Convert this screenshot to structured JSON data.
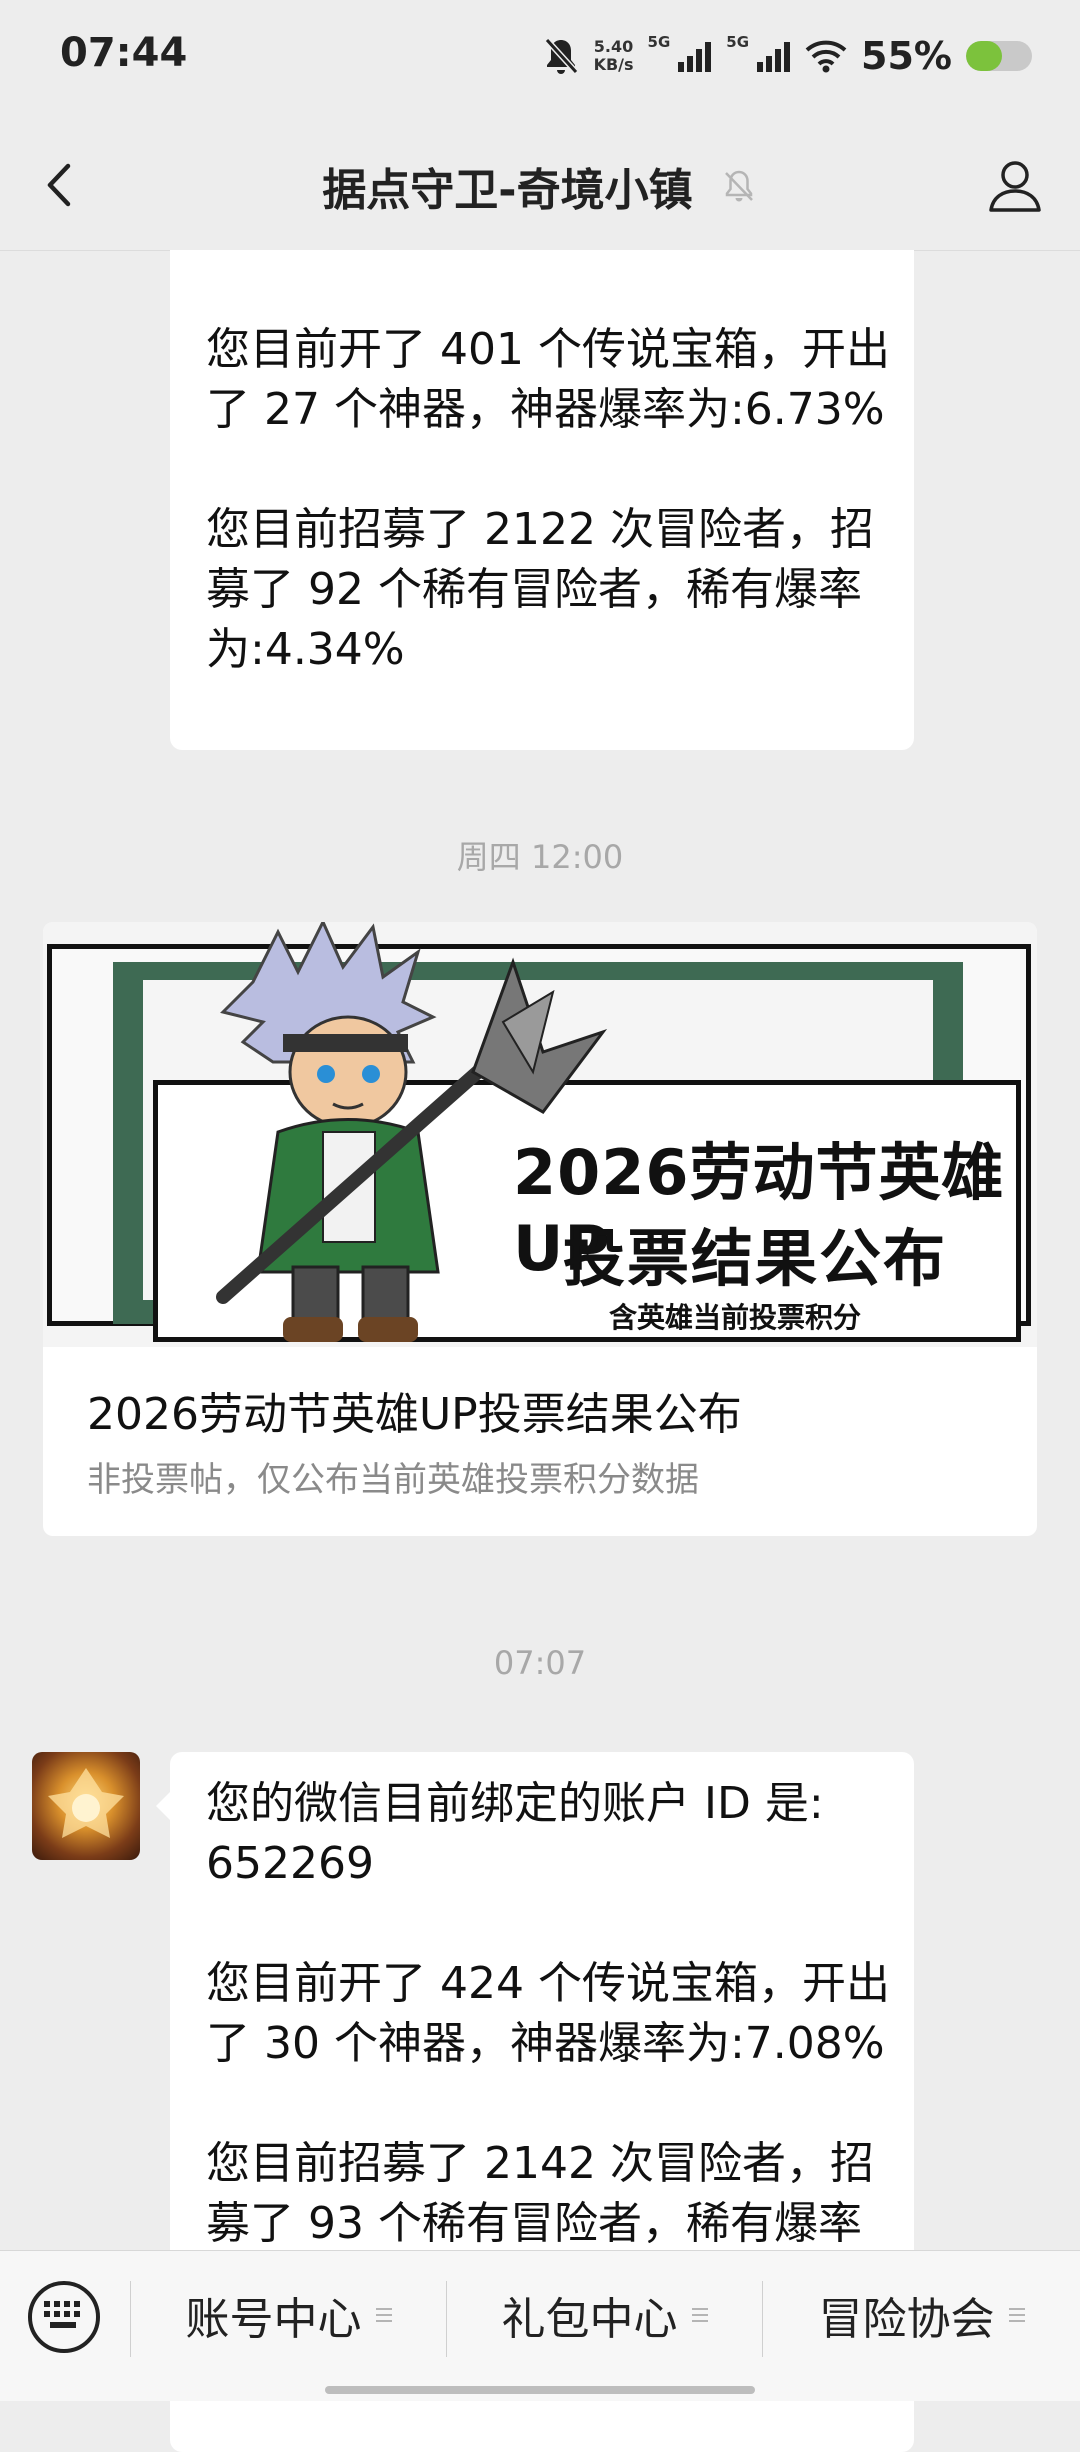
{
  "status_bar": {
    "time": "07:44",
    "net_speed_value": "5.40",
    "net_speed_unit": "KB/s",
    "signal1_label": "5G",
    "signal2_label": "5G",
    "battery_percent": "55%",
    "battery_level": 0.55,
    "icons": [
      "bell-off-icon",
      "signal-icon",
      "wifi-icon",
      "battery-icon"
    ]
  },
  "header": {
    "title": "据点守卫-奇境小镇",
    "back_icon": "chevron-left-icon",
    "mute_icon": "bell-off-icon",
    "profile_icon": "person-icon"
  },
  "messages": {
    "top_bubble_text": "您目前开了 401 个传说宝箱，开出了 27 个神器，神器爆率为:6.73%\n\n您目前招募了 2122 次冒险者，招募了 92 个稀有冒险者，稀有爆率为:4.34%",
    "timestamp1": "周四 12:00",
    "article": {
      "cover_title_line1": "2026劳动节英雄UP",
      "cover_title_line2": "投票结果公布",
      "cover_subtitle": "含英雄当前投票积分",
      "title": "2026劳动节英雄UP投票结果公布",
      "description": "非投票帖，仅公布当前英雄投票积分数据"
    },
    "timestamp2": "07:07",
    "bottom_bubble_text": "您的微信目前绑定的账户 ID 是: 652269\n\n您目前开了 424 个传说宝箱，开出了 30 个神器，神器爆率为:7.08%\n\n您目前招募了 2142 次冒险者，招募了 93 个稀有冒险者，稀有爆率"
  },
  "bottom_menu": {
    "keyboard_icon": "keyboard-icon",
    "items": [
      {
        "label": "账号中心"
      },
      {
        "label": "礼包中心"
      },
      {
        "label": "冒险协会"
      }
    ]
  }
}
